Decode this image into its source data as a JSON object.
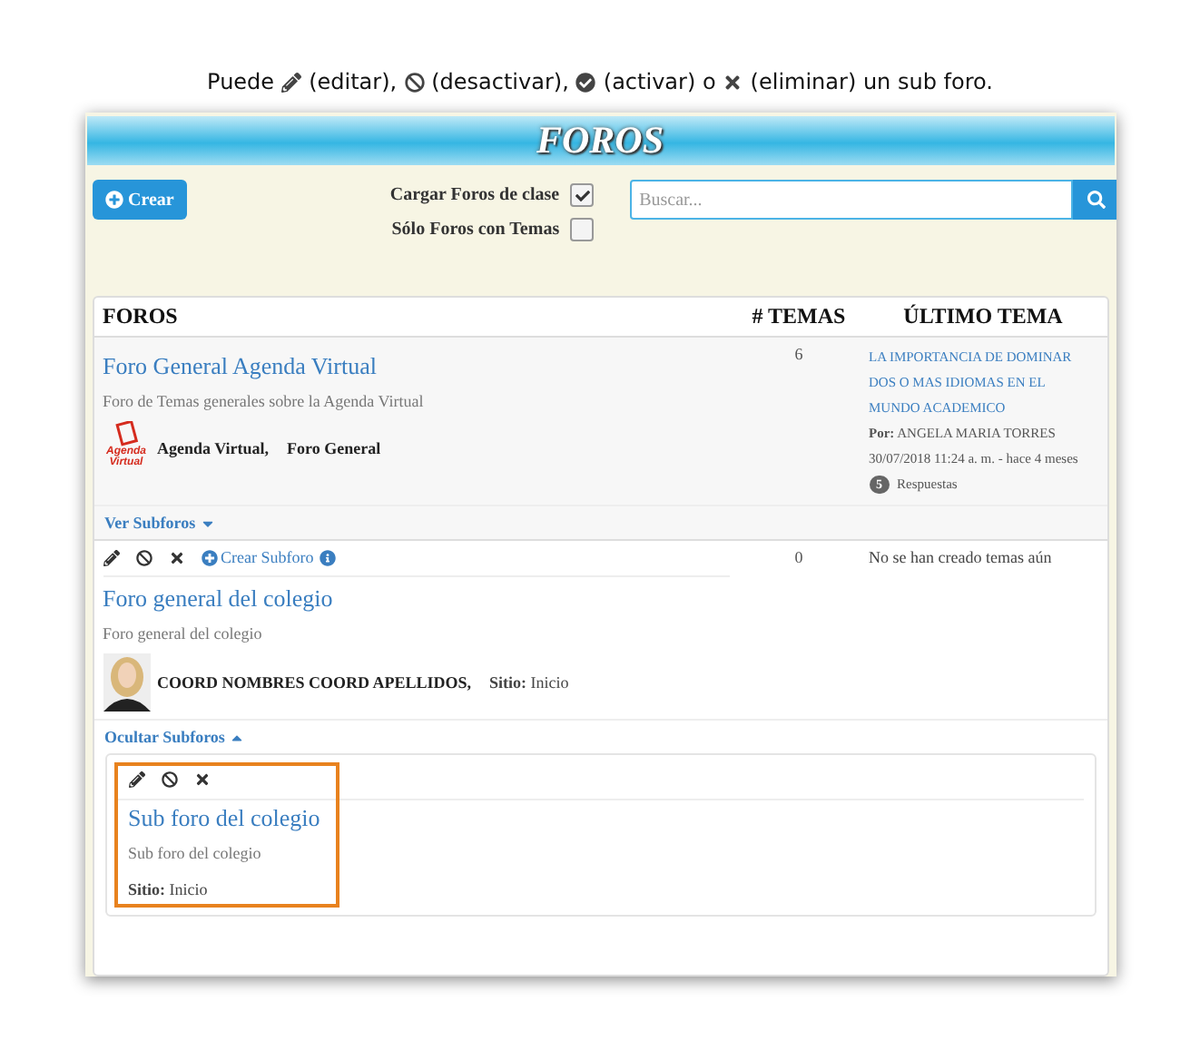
{
  "caption": {
    "parts": [
      "Puede",
      "(editar),",
      "(desactivar),",
      "(activar) o",
      "(eliminar) un sub foro."
    ]
  },
  "header": {
    "title": "FOROS"
  },
  "toolbar": {
    "create_button": "Crear",
    "filters": [
      {
        "label": "Cargar Foros de clase",
        "checked": true
      },
      {
        "label": "Sólo Foros con Temas",
        "checked": false
      }
    ],
    "search": {
      "placeholder": "Buscar..."
    }
  },
  "table": {
    "columns": [
      "FOROS",
      "# TEMAS",
      "ÚLTIMO TEMA"
    ],
    "forums": [
      {
        "kind": "main",
        "title": "Foro General Agenda Virtual",
        "description": "Foro de Temas generales sobre la Agenda Virtual",
        "logo_text": "Agenda Virtual",
        "owner": "Agenda Virtual,",
        "category": "Foro General",
        "topics": "6",
        "last_topic": {
          "title": "LA IMPORTANCIA DE DOMINAR DOS O MAS IDIOMAS EN EL MUNDO ACADEMICO",
          "by_label": "Por:",
          "author": "ANGELA MARIA TORRES",
          "date": "30/07/2018 11:24 a. m. - hace 4 meses",
          "replies_count": "5",
          "replies_label": "Respuestas"
        },
        "toggle": {
          "label": "Ver Subforos",
          "expanded": false
        }
      },
      {
        "kind": "editable",
        "create_subforum": "Crear Subforo",
        "title": "Foro general del colegio",
        "description": "Foro general del colegio",
        "owner": "COORD NOMBRES COORD APELLIDOS,",
        "site_label": "Sitio:",
        "site": "Inicio",
        "topics": "0",
        "no_topics": "No se han creado temas aún",
        "toggle": {
          "label": "Ocultar Subforos",
          "expanded": true
        },
        "subforums": [
          {
            "title": "Sub foro del colegio",
            "description": "Sub foro del colegio",
            "site_label": "Sitio:",
            "site": "Inicio",
            "highlighted": true
          }
        ]
      }
    ]
  }
}
